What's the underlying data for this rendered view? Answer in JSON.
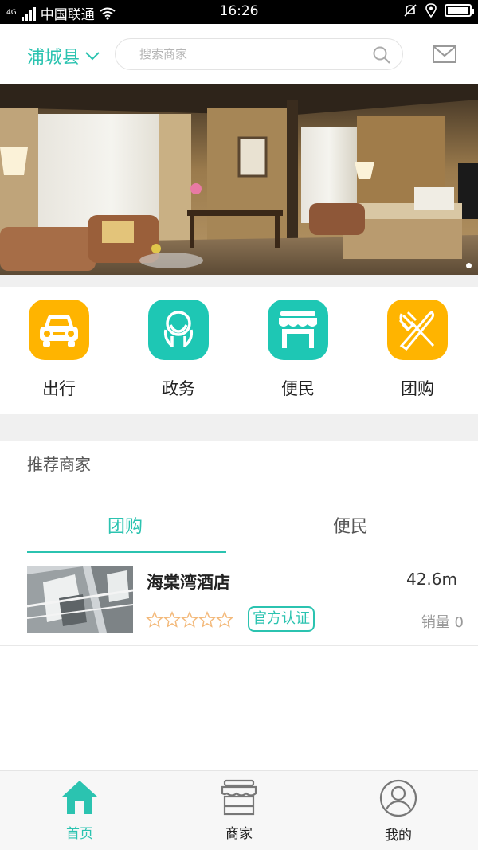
{
  "status_bar": {
    "network_type": "4G",
    "carrier": "中国联通",
    "time": "16:26"
  },
  "header": {
    "city": "浦城县",
    "search_placeholder": "搜索商家"
  },
  "categories": [
    {
      "label": "出行",
      "icon": "car-icon",
      "color": "#ffb400"
    },
    {
      "label": "政务",
      "icon": "government-icon",
      "color": "#1ec7b4"
    },
    {
      "label": "便民",
      "icon": "store-icon",
      "color": "#1ec7b4"
    },
    {
      "label": "团购",
      "icon": "fork-knife-icon",
      "color": "#ffb400"
    }
  ],
  "recommend": {
    "title": "推荐商家",
    "tabs": [
      {
        "label": "团购",
        "active": true
      },
      {
        "label": "便民",
        "active": false
      }
    ],
    "items": [
      {
        "name": "海棠湾酒店",
        "distance": "42.6m",
        "rating": 0,
        "badge": "官方认证",
        "sales": "销量 0"
      }
    ]
  },
  "bottom_nav": [
    {
      "label": "首页",
      "icon": "home-icon",
      "active": true
    },
    {
      "label": "商家",
      "icon": "shop-icon",
      "active": false
    },
    {
      "label": "我的",
      "icon": "user-icon",
      "active": false
    }
  ],
  "colors": {
    "accent": "#2bc3b0",
    "yellow": "#ffb400",
    "star": "#f3b97a"
  }
}
